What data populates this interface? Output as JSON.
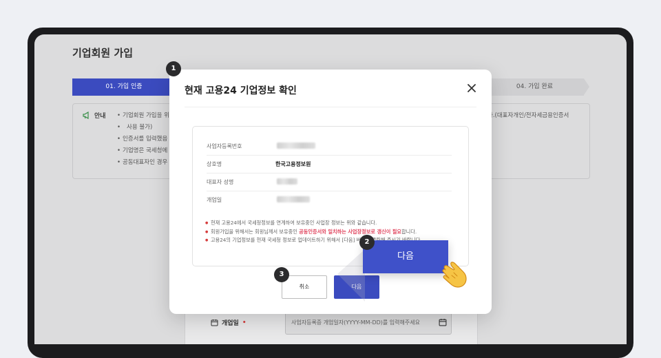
{
  "page": {
    "title": "기업회원 가입",
    "steps": [
      "01. 가입 인증",
      "04. 가입 완료"
    ],
    "notice": {
      "label": "안내",
      "items": [
        "기업회원 가입을 위",
        "사용 불가)",
        "인증서를 입력했음",
        "기업명은 국세청에",
        "공동대표자인 경우"
      ],
      "right_text": "다.(대표자개인/전자세금용인증서"
    },
    "form": {
      "label": "개업일",
      "required_mark": "•",
      "placeholder": "사업자등록증 개업일자(YYYY-MM-DD)를 입력해주세요"
    }
  },
  "modal": {
    "title": "현재 고용24 기업정보 확인",
    "rows": [
      {
        "label": "사업자등록번호",
        "value": ""
      },
      {
        "label": "상호명",
        "value": "한국고용정보원"
      },
      {
        "label": "대표자 성명",
        "value": ""
      },
      {
        "label": "개업일",
        "value": ""
      }
    ],
    "notes": {
      "n1": "현재 고용24에서 국세청정보를 연계하여 보유중인 사업장 정보는 위와 같습니다.",
      "n2_pre": "회원가입을 위해서는 회원님께서 보유중인 ",
      "n2_hl1": "공동인증서와 일치하는 사업장정보로 갱신이 필요",
      "n2_post": "합니다.",
      "n3": "고용24의 기업정보를 현재 국세청 정보로 업데이트하기 위해서 [다음] 버튼을 클릭해 주시기 바랍니다."
    },
    "cancel_label": "취소",
    "next_label": "다음"
  },
  "callout": {
    "label": "다음"
  },
  "badges": [
    "1",
    "2",
    "3"
  ],
  "colors": {
    "primary": "#3b4bbf",
    "highlight": "#e0455e"
  }
}
